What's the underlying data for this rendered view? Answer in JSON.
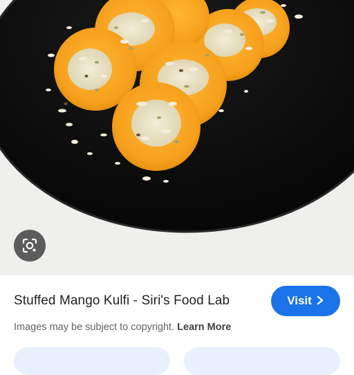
{
  "image": {
    "lens_icon": "google-lens-icon",
    "alt_subject": "mango-kulfi-photo"
  },
  "result": {
    "title": "Stuffed Mango Kulfi - Siri's Food Lab",
    "visit_label": "Visit",
    "visit_icon": "chevron-right-icon",
    "copyright_text": "Images may be subject to copyright.",
    "learn_more_label": "Learn More"
  },
  "colors": {
    "accent": "#1a73e8",
    "plate": "#0c0c0c",
    "mango": "#f5a623"
  }
}
